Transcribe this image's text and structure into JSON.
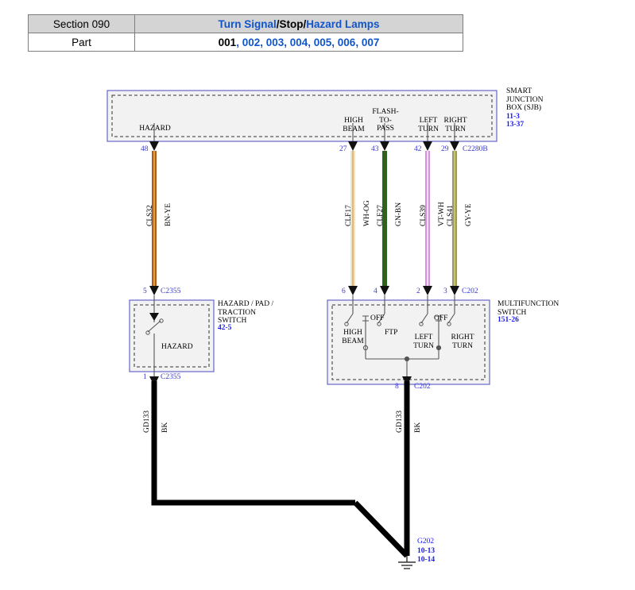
{
  "header": {
    "section_label": "Section 090",
    "title_parts": [
      {
        "text": "Turn Signal",
        "link": true
      },
      {
        "text": "/Stop/",
        "link": false
      },
      {
        "text": "Hazard Lamps",
        "link": true
      }
    ],
    "part_label": "Part",
    "part_current": "001",
    "part_others": ", 002, 003, 004, 005, 006, 007"
  },
  "diagram": {
    "sjb": {
      "name": "SMART\nJUNCTION\nBOX (SJB)",
      "links": [
        "11-3",
        "13-37"
      ],
      "connector": "C2280B",
      "terminals": [
        {
          "label": "HAZARD",
          "pin": "48"
        },
        {
          "label": "HIGH\nBEAM",
          "pin": "27"
        },
        {
          "label": "FLASH-\nTO-\nPASS",
          "pin": "43"
        },
        {
          "label": "LEFT\nTURN",
          "pin": "42"
        },
        {
          "label": "RIGHT\nTURN",
          "pin": "29"
        }
      ]
    },
    "wires": [
      {
        "circuit": "CLS32",
        "color_code": "BN-YE",
        "color": "#b45a1e",
        "stripe": "#e8c84a"
      },
      {
        "circuit": "CLF17",
        "color_code": "WH-OG",
        "color": "#efe2c8",
        "stripe": "#d8a85a"
      },
      {
        "circuit": "CLF27",
        "color_code": "GN-BN",
        "color": "#1d6b1d",
        "stripe": "#7a4a20"
      },
      {
        "circuit": "CLS39",
        "color_code": "VT-WH",
        "color": "#d98fe0",
        "stripe": "#f2f2f2"
      },
      {
        "circuit": "CLS41",
        "color_code": "GY-YE",
        "color": "#9a9a6a",
        "stripe": "#d8d060"
      }
    ],
    "hazard_switch": {
      "name": "HAZARD / PAD /\nTRACTION\nSWITCH",
      "link": "42-5",
      "inner_label": "HAZARD",
      "top_pin": "5",
      "top_connector": "C2355",
      "bottom_pin": "1",
      "bottom_connector": "C2355"
    },
    "multifunction_switch": {
      "name": "MULTIFUNCTION\nSWITCH",
      "link": "151-26",
      "connector_top": "C202",
      "pins_top": [
        "6",
        "4",
        "2",
        "3"
      ],
      "contacts": [
        {
          "label": "HIGH\nBEAM"
        },
        {
          "label": "OFF"
        },
        {
          "label": "FTP"
        },
        {
          "label": "LEFT\nTURN"
        },
        {
          "label": "OFF"
        },
        {
          "label": "RIGHT\nTURN"
        }
      ],
      "bottom_pin": "8",
      "bottom_connector": "C202"
    },
    "grounds": [
      {
        "circuit": "GD133",
        "color_code": "BK"
      },
      {
        "circuit": "GD133",
        "color_code": "BK"
      }
    ],
    "ground_point": {
      "name": "G202",
      "links": [
        "10-13",
        "10-14"
      ]
    }
  }
}
